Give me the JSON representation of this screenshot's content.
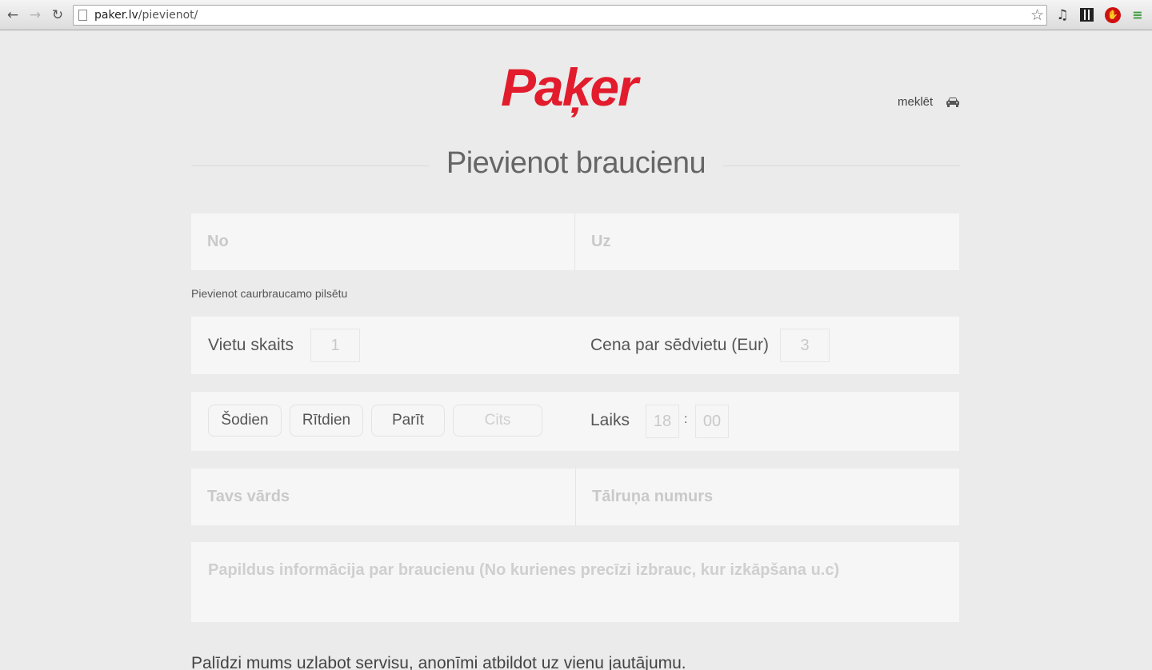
{
  "browser": {
    "url_host": "paker.lv",
    "url_path": "/pievienot/",
    "icons": [
      "back-icon",
      "forward-icon",
      "reload-icon",
      "page-icon",
      "star-icon",
      "music-icon",
      "qr-code-icon",
      "stop-icon",
      "menu-icon"
    ]
  },
  "header": {
    "logo": "Paķer",
    "search_link": "meklēt",
    "brand_color": "#e21c2c"
  },
  "page": {
    "title": "Pievienot braucienu"
  },
  "route": {
    "from_placeholder": "No",
    "to_placeholder": "Uz",
    "add_city_link": "Pievienot caurbraucamo pilsētu"
  },
  "seats": {
    "label": "Vietu skaits",
    "value": "1",
    "price_label": "Cena par sēdvietu (Eur)",
    "price_value": "3"
  },
  "date": {
    "options": [
      "Šodien",
      "Rītdien",
      "Parīt",
      "Cits"
    ],
    "time_label": "Laiks",
    "hour": "18",
    "separator": ":",
    "minute": "00"
  },
  "contact": {
    "name_placeholder": "Tavs vārds",
    "phone_placeholder": "Tālruņa numurs"
  },
  "extra": {
    "info_placeholder": "Papildus informācija par braucienu (No kurienes precīzi izbrauc, kur izkāpšana u.c)"
  },
  "survey": {
    "text": "Palīdzi mums uzlabot servisu, anonīmi atbildot uz vienu jautājumu."
  }
}
